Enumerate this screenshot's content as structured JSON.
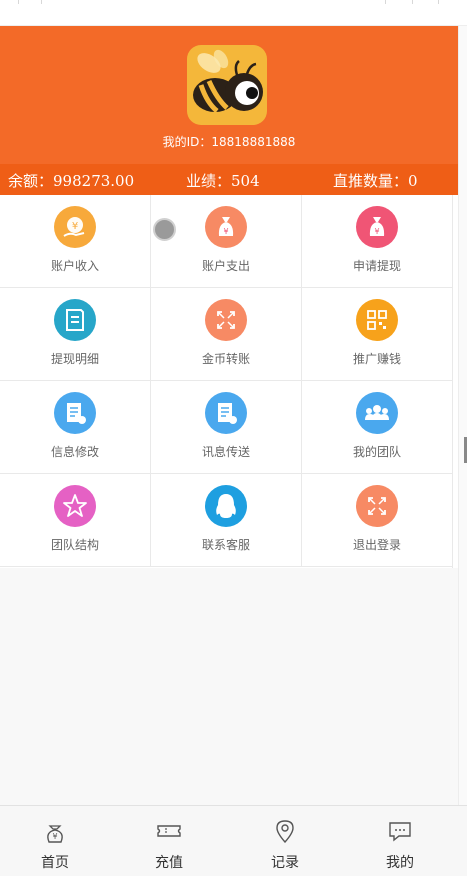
{
  "colors": {
    "header_bg": "#f36a28",
    "stats_bg": "#ef5e16",
    "label_text": "#666666"
  },
  "header": {
    "user_id_label": "我的ID：",
    "user_id_value": "18818881888"
  },
  "stats": {
    "balance_label": "余额：",
    "balance_value": "998273.00",
    "performance_label": "业绩：",
    "performance_value": "504",
    "referrals_label": "直推数量：",
    "referrals_value": "0"
  },
  "menu": [
    {
      "label": "账户收入",
      "icon": "coin-hand-icon",
      "color": "#f7a93b"
    },
    {
      "label": "账户支出",
      "icon": "money-bag-icon",
      "color": "#f78a64"
    },
    {
      "label": "申请提现",
      "icon": "money-bag-icon",
      "color": "#f05575"
    },
    {
      "label": "提现明细",
      "icon": "document-icon",
      "color": "#27a6c9"
    },
    {
      "label": "金币转账",
      "icon": "expand-arrows-icon",
      "color": "#f78a64"
    },
    {
      "label": "推广赚钱",
      "icon": "qr-code-icon",
      "color": "#f7a21b"
    },
    {
      "label": "信息修改",
      "icon": "edit-document-icon",
      "color": "#4aa8ee"
    },
    {
      "label": "讯息传送",
      "icon": "edit-document-icon",
      "color": "#4aa8ee"
    },
    {
      "label": "我的团队",
      "icon": "team-icon",
      "color": "#4aa8ee"
    },
    {
      "label": "团队结构",
      "icon": "star-icon",
      "color": "#e561c4"
    },
    {
      "label": "联系客服",
      "icon": "penguin-icon",
      "color": "#1e9fe0"
    },
    {
      "label": "退出登录",
      "icon": "expand-arrows-icon",
      "color": "#f78a64"
    }
  ],
  "tabbar": [
    {
      "label": "首页",
      "icon": "yen-bag-icon"
    },
    {
      "label": "充值",
      "icon": "ticket-icon"
    },
    {
      "label": "记录",
      "icon": "location-pin-icon"
    },
    {
      "label": "我的",
      "icon": "chat-bubble-icon"
    }
  ]
}
